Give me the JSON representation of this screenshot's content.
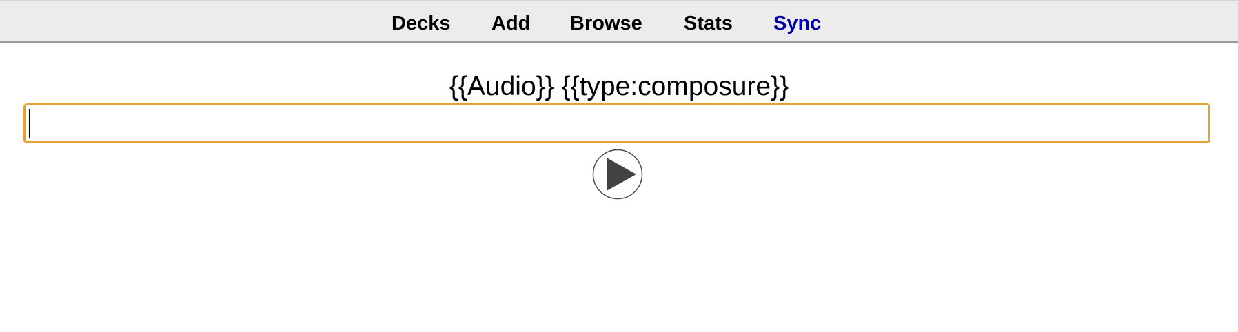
{
  "toolbar": {
    "items": [
      {
        "label": "Decks"
      },
      {
        "label": "Add"
      },
      {
        "label": "Browse"
      },
      {
        "label": "Stats"
      },
      {
        "label": "Sync"
      }
    ],
    "sync_color": "#0000aa"
  },
  "card": {
    "template_text": "{{Audio}} {{type:composure}}",
    "typebox_value": "",
    "typebox_border_color": "#e8a033",
    "play_icon": "play-icon"
  }
}
